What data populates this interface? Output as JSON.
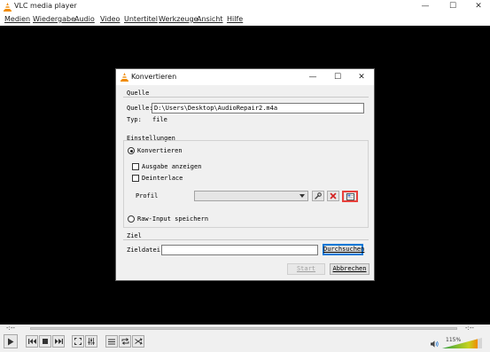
{
  "app": {
    "window_title": "VLC media player",
    "window_buttons": {
      "minimize": "—",
      "maximize": "☐",
      "close": "✕"
    }
  },
  "menu": {
    "items": [
      "Medien",
      "Wiedergabe",
      "Audio",
      "Video",
      "Untertitel",
      "Werkzeuge",
      "Ansicht",
      "Hilfe"
    ]
  },
  "player": {
    "elapsed": "-:--",
    "remaining": "-:--",
    "volume_percent": "115%",
    "controls": [
      "play-icon",
      "previous-icon",
      "stop-icon",
      "next-icon",
      "fullscreen-icon",
      "extended-settings-icon",
      "playlist-icon",
      "loop-icon",
      "shuffle-icon",
      "speaker-icon"
    ]
  },
  "dialog": {
    "title": "Konvertieren",
    "window_buttons": {
      "minimize": "—",
      "maximize": "☐",
      "close": "✕"
    },
    "source": {
      "group_label": "Quelle",
      "field_label": "Quelle:",
      "field_value": "D:\\Users\\Desktop\\AudioRepair2.m4a",
      "type_label": "Typ:",
      "type_value": "file"
    },
    "settings": {
      "group_label": "Einstellungen",
      "convert_label": "Konvertieren",
      "convert_selected": true,
      "show_output_label": "Ausgabe anzeigen",
      "show_output_checked": false,
      "deinterlace_label": "Deinterlace",
      "deinterlace_checked": false,
      "profile_label": "Profil",
      "profile_value": "",
      "raw_input_label": "Raw-Input speichern",
      "raw_input_selected": false
    },
    "destination": {
      "group_label": "Ziel",
      "file_label": "Zieldatei:",
      "file_value": "",
      "browse_label": "Durchsuchen"
    },
    "buttons": {
      "start_label": "Start",
      "cancel_label": "Abbrechen"
    },
    "colors": {
      "highlight": "#e8413c",
      "default_button_border": "#0078d7"
    }
  }
}
